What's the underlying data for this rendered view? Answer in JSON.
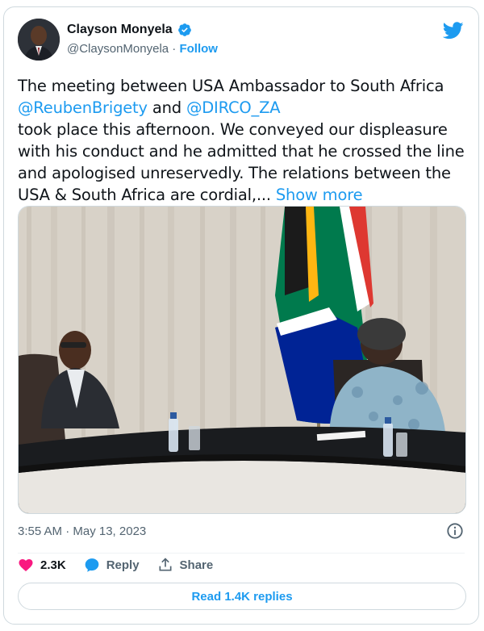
{
  "author": {
    "name": "Clayson Monyela",
    "handle": "@ClaysonMonyela",
    "separator": "·",
    "follow_label": "Follow"
  },
  "tweet": {
    "line1": "The meeting between USA Ambassador to South Africa",
    "mention1": "@ReubenBrigety",
    "and_word": " and ",
    "mention2": "@DIRCO_ZA",
    "body": "took place this afternoon. We conveyed our displeasure with his conduct and he admitted that he crossed the line and apologised unreservedly. The relations between the USA & South Africa are cordial,...",
    "show_more_label": "Show more"
  },
  "meta": {
    "timestamp": "3:55 AM · May 13, 2023"
  },
  "actions": {
    "likes": "2.3K",
    "reply_label": "Reply",
    "share_label": "Share"
  },
  "read_replies_label": "Read 1.4K replies",
  "colors": {
    "accent": "#1d9bf0",
    "like": "#f91880",
    "secondary_text": "#536471",
    "border": "#cfd9de"
  },
  "icons": [
    "verified-badge-icon",
    "twitter-bird-icon",
    "info-icon",
    "heart-icon",
    "reply-icon",
    "share-icon"
  ]
}
